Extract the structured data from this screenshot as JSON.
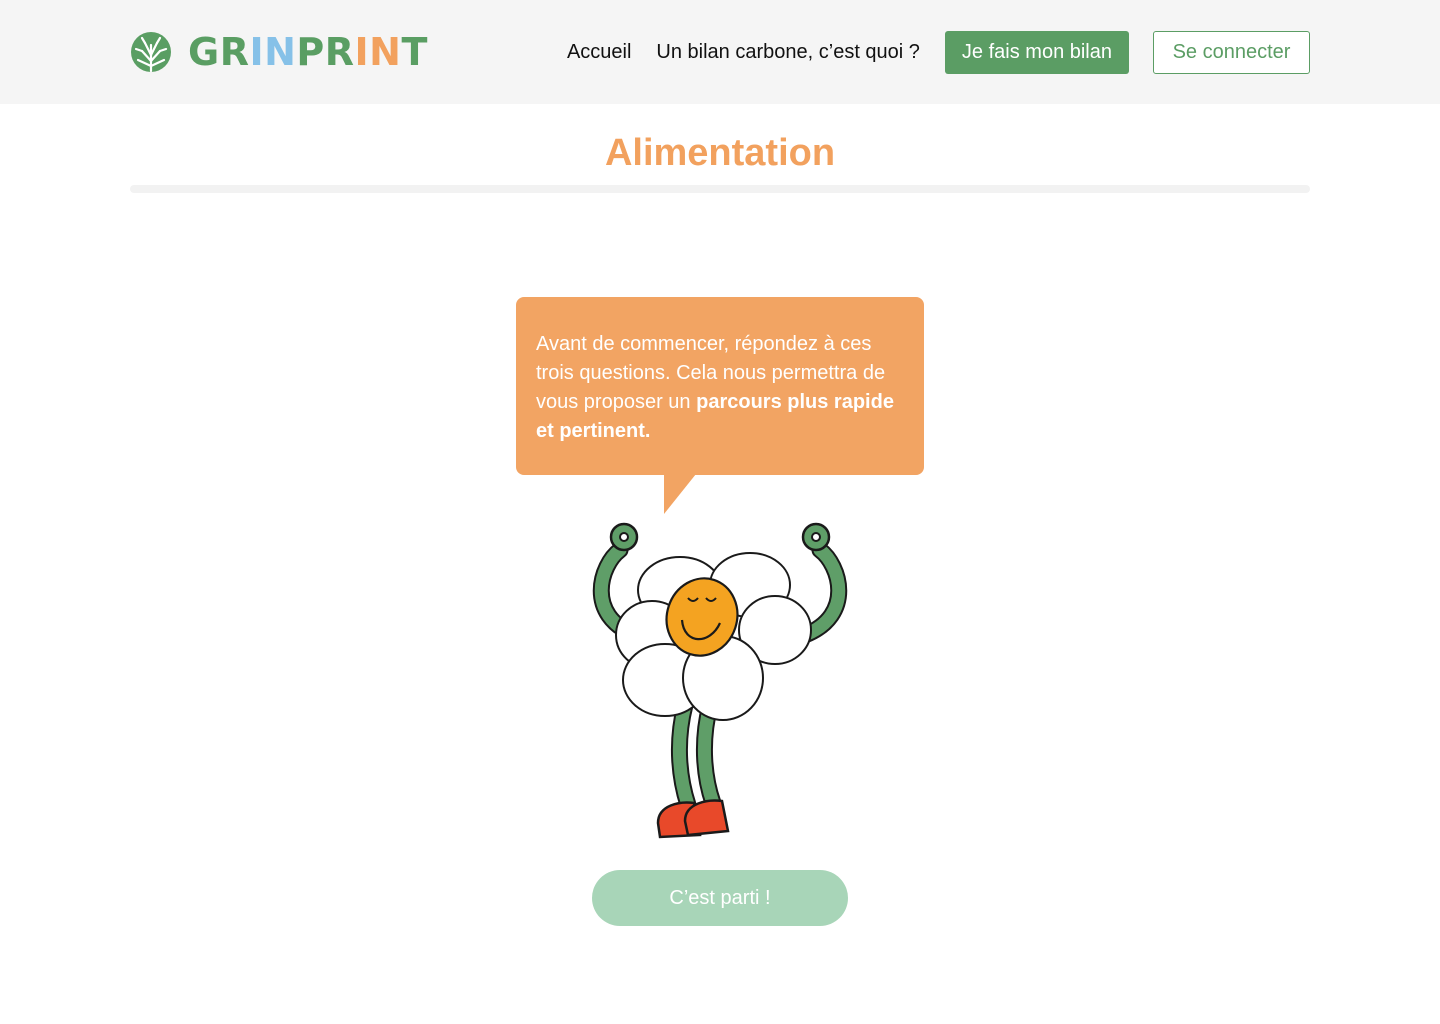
{
  "brand": {
    "parts": [
      "GR",
      "IN",
      "PR",
      "IN",
      "T"
    ],
    "colors": {
      "green": "#5a9e63",
      "blue": "#86c1e8",
      "orange": "#f2a15e"
    },
    "icon": "tree-icon"
  },
  "nav": {
    "home": "Accueil",
    "about": "Un bilan carbone, c’est quoi ?",
    "start_label": "Je fais mon bilan",
    "login_label": "Se connecter"
  },
  "page": {
    "title": "Alimentation",
    "progress_fraction": 0
  },
  "intro": {
    "text_plain": "Avant de commencer, répondez à ces trois questions. Cela nous permettra de vous proposer un ",
    "text_bold": "parcours plus rapide et pertinent."
  },
  "mascot": {
    "icon": "flower-mascot-icon"
  },
  "cta": {
    "label": "C’est parti !"
  },
  "colors": {
    "accent_green": "#5b9d64",
    "accent_orange": "#f2a463",
    "cta_disabled": "#a8d5b8",
    "header_bg": "#f5f5f5"
  }
}
